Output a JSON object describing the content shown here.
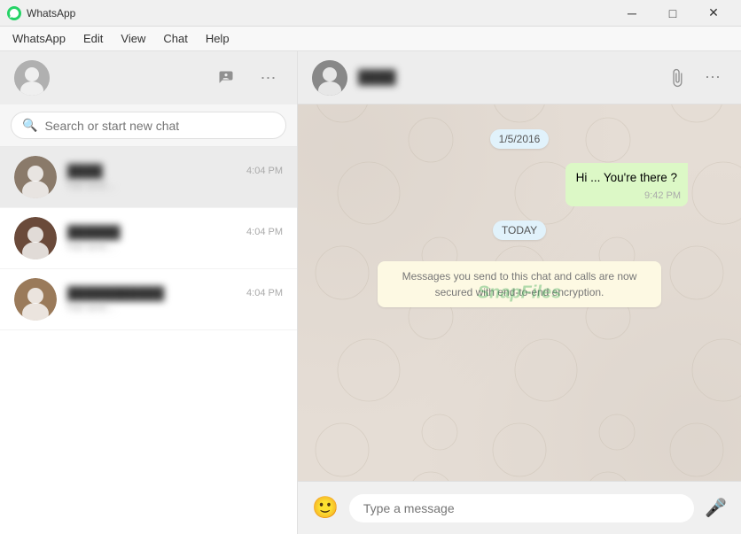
{
  "window": {
    "icon": "whatsapp-icon",
    "title": "WhatsApp",
    "controls": {
      "minimize": "─",
      "maximize": "□",
      "close": "✕"
    }
  },
  "menubar": {
    "items": [
      "WhatsApp",
      "Edit",
      "View",
      "Chat",
      "Help"
    ]
  },
  "left_panel": {
    "header": {
      "new_chat_label": "+",
      "more_options_label": "⋯"
    },
    "search": {
      "placeholder": "Search or start new chat"
    },
    "chats": [
      {
        "name": "████",
        "preview": "hat and...",
        "time": "4:04 PM",
        "avatar_color": "#8a7a6a"
      },
      {
        "name": "██████",
        "preview": "hat and...",
        "time": "4:04 PM",
        "avatar_color": "#6a4a3a"
      },
      {
        "name": "███████████",
        "preview": "hat and...",
        "time": "4:04 PM",
        "avatar_color": "#9a7a5a"
      }
    ]
  },
  "right_panel": {
    "header": {
      "contact_name": "████"
    },
    "messages": [
      {
        "type": "date",
        "text": "1/5/2016"
      },
      {
        "type": "sent",
        "text": "Hi ... You're there ?",
        "time": "9:42 PM"
      },
      {
        "type": "date",
        "text": "TODAY"
      },
      {
        "type": "info",
        "text": "Messages you send to this chat and calls are now secured with end-to-end encryption."
      }
    ],
    "input": {
      "placeholder": "Type a message"
    },
    "watermark": "SnapFiles"
  },
  "icons": {
    "search": "🔍",
    "paperclip": "📎",
    "more": "⋯",
    "emoji": "🙂",
    "mic": "🎤",
    "profile": "👤"
  }
}
